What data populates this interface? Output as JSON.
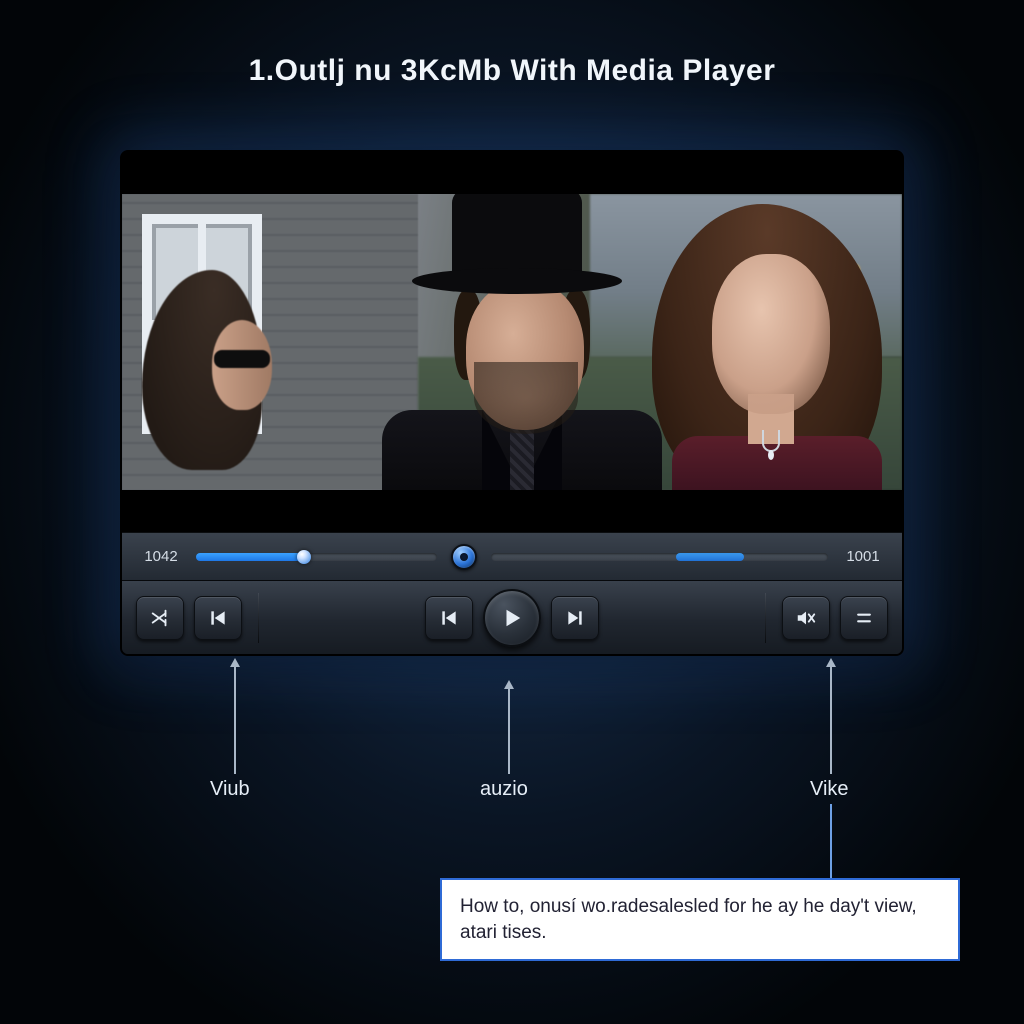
{
  "title": "1.Outlj nu 3KcMb With Media Player",
  "player": {
    "time_current": "1042",
    "time_total": "1001",
    "seek_percent": 45
  },
  "controls": {
    "shuffle": "shuffle",
    "prev": "previous",
    "skip_back": "skip-back",
    "play": "play",
    "skip_fwd": "skip-forward",
    "mute": "mute",
    "menu": "menu"
  },
  "callouts": {
    "left": "Viub",
    "center": "auzio",
    "right": "Vike"
  },
  "tip": "How to, onusí wo.radesalesled for he ay he day't view, atari tises.",
  "colors": {
    "accent": "#2e86ff"
  }
}
